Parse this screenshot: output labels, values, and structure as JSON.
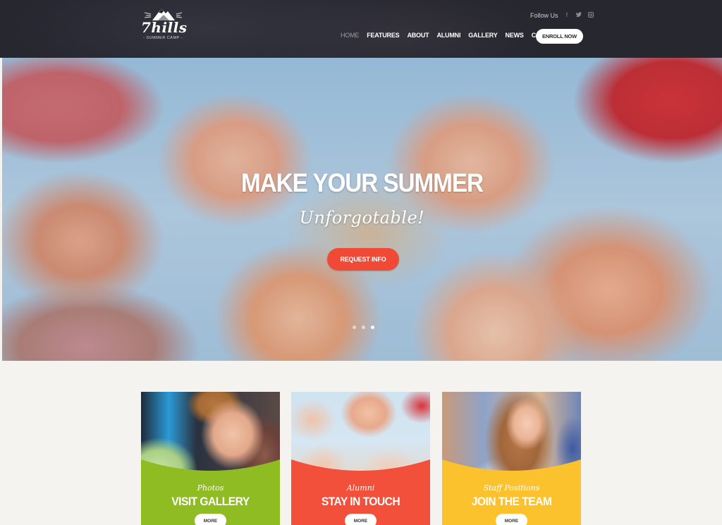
{
  "header": {
    "logo": {
      "name": "7hills",
      "tagline": "- SUMMER CAMP -",
      "icon": "mountain-icon"
    },
    "follow": {
      "label": "Follow Us",
      "icons": [
        {
          "name": "facebook-icon",
          "glyph": "f"
        },
        {
          "name": "twitter-icon",
          "glyph": "t"
        },
        {
          "name": "instagram-icon",
          "glyph": "◙"
        }
      ]
    },
    "nav": {
      "items": [
        {
          "label": "HOME",
          "active": true
        },
        {
          "label": "FEATURES",
          "active": false
        },
        {
          "label": "ABOUT",
          "active": false
        },
        {
          "label": "ALUMNI",
          "active": false
        },
        {
          "label": "GALLERY",
          "active": false
        },
        {
          "label": "NEWS",
          "active": false
        },
        {
          "label": "CONTACTS",
          "active": false
        }
      ],
      "cta_label": "ENROLL NOW"
    }
  },
  "hero": {
    "title": "MAKE YOUR SUMMER",
    "subtitle": "Unforgotable!",
    "button_label": "REQUEST INFO",
    "slides_total": 3,
    "active_slide": 3
  },
  "cards": [
    {
      "kicker": "Photos",
      "title": "VISIT GALLERY",
      "button_label": "MORE",
      "color": "#8fbb23"
    },
    {
      "kicker": "Alumni",
      "title": "STAY IN TOUCH",
      "button_label": "MORE",
      "color": "#f2503a"
    },
    {
      "kicker": "Staff Positions",
      "title": "JOIN THE TEAM",
      "button_label": "MORE",
      "color": "#fcc22e"
    }
  ],
  "colors": {
    "header_bg": "#272730",
    "accent": "#f04a36",
    "page_bg": "#f5f3f0"
  }
}
